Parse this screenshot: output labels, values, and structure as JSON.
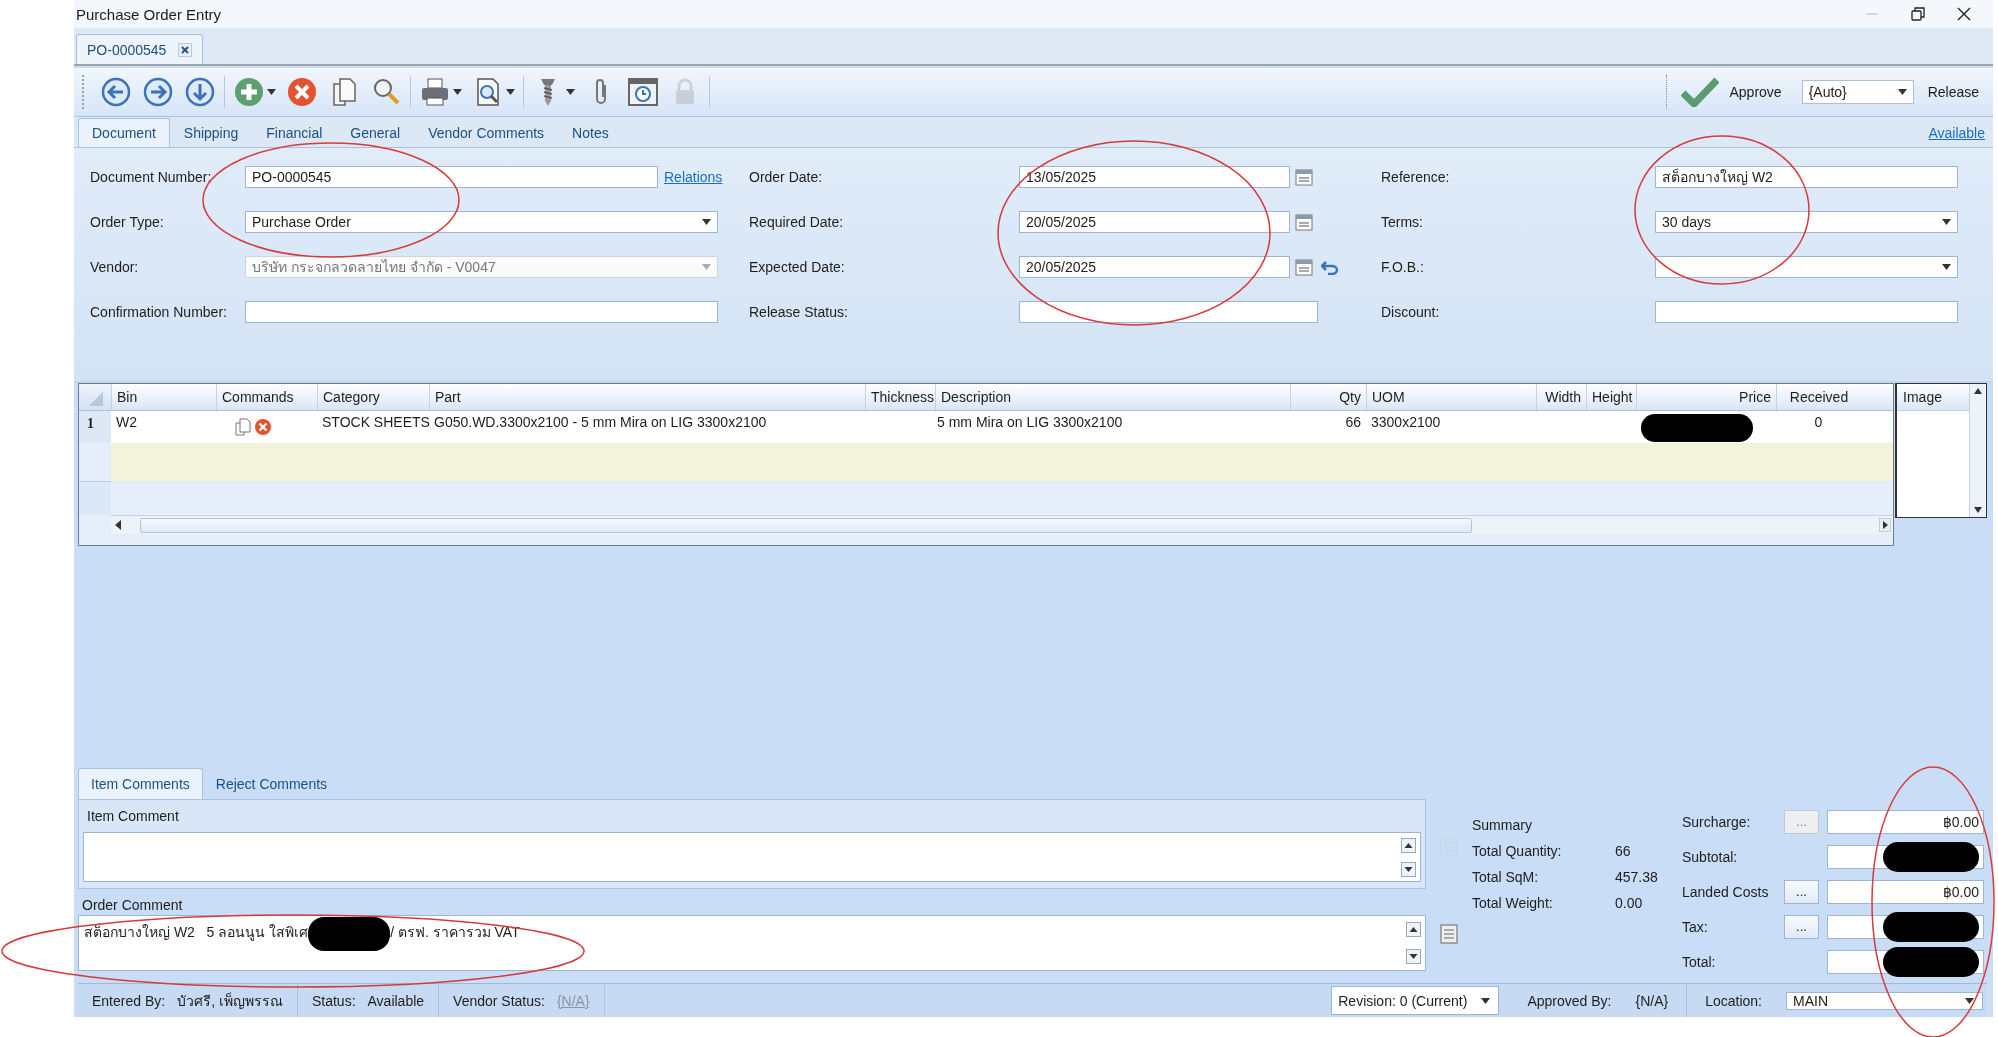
{
  "window": {
    "title": "Purchase Order Entry"
  },
  "document_tabs": [
    {
      "label": "PO-0000545",
      "selected": true
    }
  ],
  "toolbar": {
    "groups": [
      [
        {
          "kind": "back"
        },
        {
          "kind": "forward"
        },
        {
          "kind": "down"
        }
      ],
      [
        {
          "kind": "add",
          "menu": true
        },
        {
          "kind": "delete"
        },
        {
          "kind": "copy"
        },
        {
          "kind": "search"
        }
      ],
      [
        {
          "kind": "print",
          "menu": true
        },
        {
          "kind": "preview",
          "menu": true
        }
      ],
      [
        {
          "kind": "tools",
          "menu": true
        },
        {
          "kind": "attach"
        },
        {
          "kind": "schedule"
        },
        {
          "kind": "lock",
          "disabled": true
        }
      ]
    ],
    "approve": {
      "label": "Approve"
    },
    "release_mode": {
      "value": "{Auto}"
    },
    "release": {
      "label": "Release"
    }
  },
  "tabs": [
    {
      "label": "Document",
      "selected": true
    },
    {
      "label": "Shipping",
      "selected": false
    },
    {
      "label": "Financial",
      "selected": false
    },
    {
      "label": "General",
      "selected": false
    },
    {
      "label": "Vendor Comments",
      "selected": false
    },
    {
      "label": "Notes",
      "selected": false
    }
  ],
  "availability_link": "Available",
  "form": {
    "columns": [
      [
        {
          "label": "Document Number:",
          "kind": "text",
          "value": "PO-0000545",
          "link": "Relations"
        },
        {
          "label": "Order Type:",
          "kind": "select",
          "value": "Purchase Order"
        },
        {
          "label": "Vendor:",
          "kind": "select",
          "value": "บริษัท กระจกลวดลายไทย จำกัด - V0047",
          "disabled": true
        },
        {
          "label": "Confirmation Number:",
          "kind": "text"
        }
      ],
      [
        {
          "label": "Order Date:",
          "kind": "date",
          "value": "13/05/2025"
        },
        {
          "label": "Required Date:",
          "kind": "date",
          "value": "20/05/2025"
        },
        {
          "label": "Expected Date:",
          "kind": "date",
          "value": "20/05/2025",
          "reset": true
        },
        {
          "label": "Release Status:",
          "kind": "text"
        }
      ],
      [
        {
          "label": "Reference:",
          "kind": "text",
          "value": "สต็อกบางใหญ่ W2"
        },
        {
          "label": "Terms:",
          "kind": "select",
          "value": "30 days"
        },
        {
          "label": "F.O.B.:",
          "kind": "select"
        },
        {
          "label": "Discount:",
          "kind": "text"
        }
      ]
    ]
  },
  "grid": {
    "columns": [
      "Bin",
      "Commands",
      "Category",
      "Part",
      "Thickness",
      "Description",
      "Qty",
      "UOM",
      "Width",
      "Height",
      "Price",
      "Received"
    ],
    "image_column": "Image",
    "rows": [
      {
        "number": "1",
        "bin": "W2",
        "commands": [
          {
            "kind": "copy"
          },
          {
            "kind": "delete"
          }
        ],
        "category": "STOCK SHEETS",
        "part": "G050.WD.3300x2100 - 5 mm Mira on LIG 3300x2100",
        "description": "5 mm Mira on LIG 3300x2100",
        "qty": "66",
        "uom": "3300x2100",
        "price_redacted": true,
        "received": "0"
      }
    ]
  },
  "comment_tabs": [
    {
      "label": "Item Comments",
      "selected": true
    },
    {
      "label": "Reject Comments",
      "selected": false
    }
  ],
  "item_comment": {
    "label": "Item Comment"
  },
  "order_comment": {
    "label": "Order Comment",
    "segments": [
      "สต็อกบางใหญ่ W2   5 ลอนนูน ใสพิเศ",
      "/ ตรฟ. ราคารวม VAT"
    ]
  },
  "summary": {
    "title": "Summary",
    "rows": [
      {
        "label": "Total Quantity:",
        "value": "66"
      },
      {
        "label": "Total SqM:",
        "value": "457.38"
      },
      {
        "label": "Total Weight:",
        "value": "0.00"
      }
    ]
  },
  "totals": [
    {
      "label": "Surcharge:",
      "value": "฿0.00",
      "button": "...",
      "button_disabled": true
    },
    {
      "label": "Subtotal:",
      "redacted": true
    },
    {
      "label": "Landed Costs",
      "value": "฿0.00",
      "button": "...",
      "button_disabled": false
    },
    {
      "label": "Tax:",
      "redacted": true,
      "button": "...",
      "button_disabled": false
    },
    {
      "label": "Total:",
      "redacted": true
    }
  ],
  "status_bar": {
    "left": [
      {
        "kind": "text",
        "label": "Entered By:",
        "value": "บัวศรี, เพ็ญพรรณ"
      },
      {
        "kind": "text",
        "label": "Status:",
        "value": "Available"
      },
      {
        "kind": "link",
        "label": "Vendor Status:",
        "value": "{N/A}"
      }
    ],
    "right": [
      {
        "kind": "select",
        "value": "Revision: 0 (Current)"
      },
      {
        "kind": "text",
        "label": "Approved By:",
        "value": "{N/A}"
      },
      {
        "kind": "select",
        "label": "Location:",
        "value": "MAIN"
      }
    ]
  },
  "markup": [
    {
      "kind": "ellipse"
    },
    {
      "kind": "ellipse"
    },
    {
      "kind": "ellipse"
    },
    {
      "kind": "ellipse"
    },
    {
      "kind": "ellipse"
    }
  ]
}
